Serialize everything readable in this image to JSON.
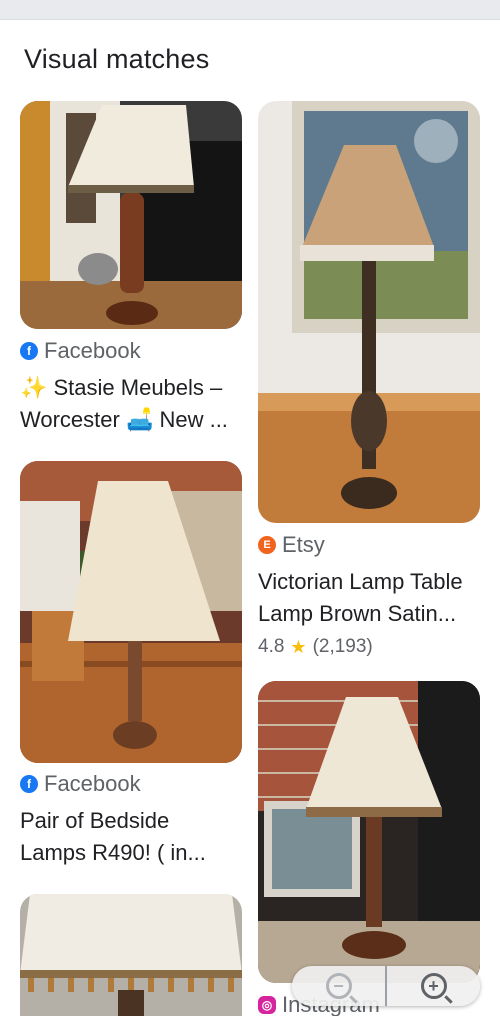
{
  "section": {
    "title": "Visual matches"
  },
  "results": [
    {
      "source": "Facebook",
      "source_icon": "facebook-icon",
      "title_lines": [
        "✨ Stasie Meubels –",
        "Worcester 🛋️ New ..."
      ]
    },
    {
      "source": "Etsy",
      "source_icon": "etsy-icon",
      "title_lines": [
        "Victorian Lamp Table",
        "Lamp Brown Satin..."
      ],
      "rating": "4.8",
      "reviews": "(2,193)"
    },
    {
      "source": "Facebook",
      "source_icon": "facebook-icon",
      "title_lines": [
        "Pair of Bedside",
        "Lamps R490! ( in..."
      ]
    },
    {
      "source": "Instagram",
      "source_icon": "instagram-icon",
      "title_lines": []
    },
    {
      "source": "",
      "source_icon": "",
      "title_lines": []
    }
  ],
  "icons": {
    "facebook": "f",
    "etsy": "E",
    "instagram": "◎",
    "star": "★",
    "zoom_out": "−",
    "zoom_in": "+"
  },
  "colors": {
    "facebook": "#1877f2",
    "etsy": "#f1641e",
    "instagram": "#d6249f",
    "star": "#fbbc04"
  }
}
